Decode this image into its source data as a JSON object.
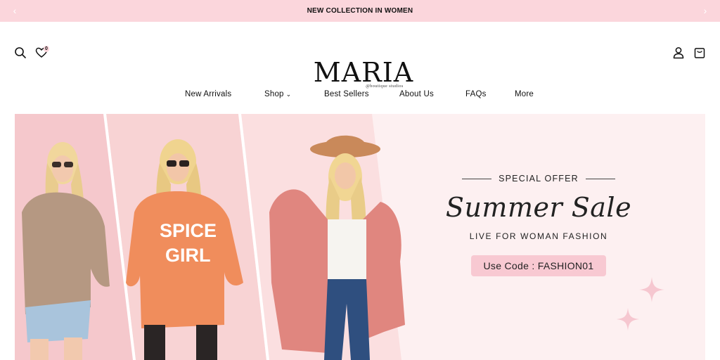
{
  "announcement": {
    "text": "NEW COLLECTION IN WOMEN",
    "prev_icon": "chevron-left-icon",
    "next_icon": "chevron-right-icon"
  },
  "header": {
    "logo": {
      "brand": "MARIA",
      "tagline": "@boutique studios"
    },
    "wishlist_count": "0",
    "icons": [
      "search-icon",
      "heart-icon",
      "user-icon",
      "shopping-bag-icon"
    ]
  },
  "nav": {
    "items": [
      {
        "label": "New Arrivals"
      },
      {
        "label": "Shop",
        "has_dropdown": true
      },
      {
        "label": "Best Sellers"
      },
      {
        "label": "About Us"
      },
      {
        "label": "FAQs"
      },
      {
        "label": "More"
      }
    ]
  },
  "hero": {
    "eyebrow": "SPECIAL OFFER",
    "title": "Summer Sale",
    "subtitle": "LIVE FOR WOMAN FASHION",
    "code_label": "Use Code : FASHION01",
    "model_shirt_text_line1": "SPICE",
    "model_shirt_text_line2": "GIRL",
    "colors": {
      "background": "#fdf0f1",
      "button": "#f8c9d2",
      "panel": "#f7d5d8"
    }
  }
}
